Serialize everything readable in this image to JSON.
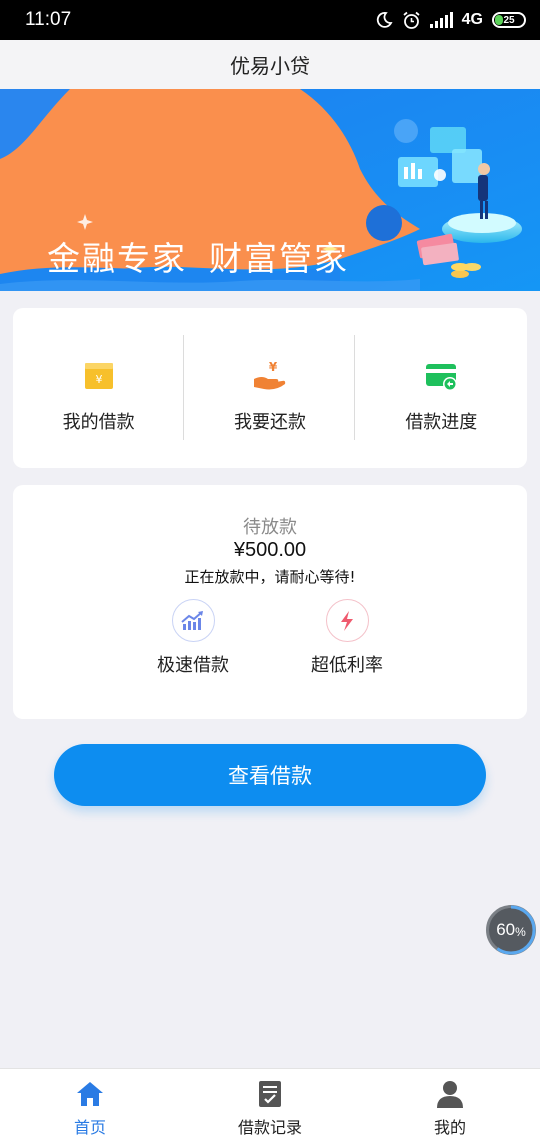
{
  "status_bar": {
    "time": "11:07",
    "network": "4G",
    "battery": "25",
    "icons": [
      "moon-icon",
      "alarm-icon",
      "signal-icon",
      "battery-icon"
    ]
  },
  "header": {
    "title": "优易小贷"
  },
  "banner": {
    "slogan_part1": "金融专家",
    "slogan_part2": "财富管家"
  },
  "quick_actions": [
    {
      "label": "我的借款",
      "icon": "wallet-icon",
      "color": "#f7c02b"
    },
    {
      "label": "我要还款",
      "icon": "hand-yen-icon",
      "color": "#f08234"
    },
    {
      "label": "借款进度",
      "icon": "card-progress-icon",
      "color": "#1ec05c"
    }
  ],
  "loan_status": {
    "label": "待放款",
    "amount": "¥500.00",
    "message": "正在放款中，请耐心等待!"
  },
  "features": [
    {
      "label": "极速借款",
      "icon": "chart-up-icon",
      "color": "#6b86e8"
    },
    {
      "label": "超低利率",
      "icon": "lightning-icon",
      "color": "#ef5a6e"
    }
  ],
  "main_button": {
    "label": "查看借款"
  },
  "floating_widget": {
    "value": "60",
    "unit": "%"
  },
  "tabs": [
    {
      "label": "首页",
      "icon": "home-icon",
      "active": true
    },
    {
      "label": "借款记录",
      "icon": "document-icon",
      "active": false
    },
    {
      "label": "我的",
      "icon": "user-icon",
      "active": false
    }
  ],
  "colors": {
    "accent": "#0d8df0",
    "tab_active": "#2a7be4",
    "banner_blue": "#1a84f0",
    "banner_orange": "#fa8f4d"
  }
}
